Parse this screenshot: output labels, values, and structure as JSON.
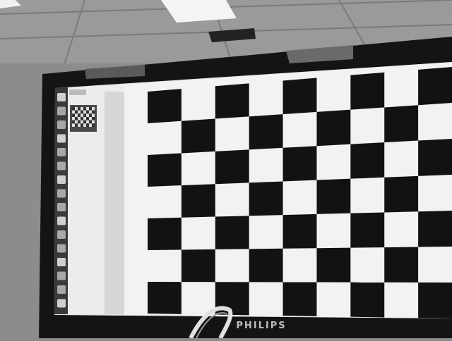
{
  "photo": {
    "subject": "monitor-displaying-checkerboard",
    "monitor_brand": "PHILIPS",
    "board": {
      "columns": 9,
      "rows": 7,
      "first_square": "black"
    },
    "launcher_icon_count": 16,
    "colors": {
      "ceiling": "#9a9a9a",
      "wall": "#8c8c8c",
      "bezel": "#141414",
      "launcher": "#3a3a3a",
      "sidebar": "#e8e8e8",
      "board_light": "#f2f2f2",
      "board_dark": "#121212"
    }
  }
}
